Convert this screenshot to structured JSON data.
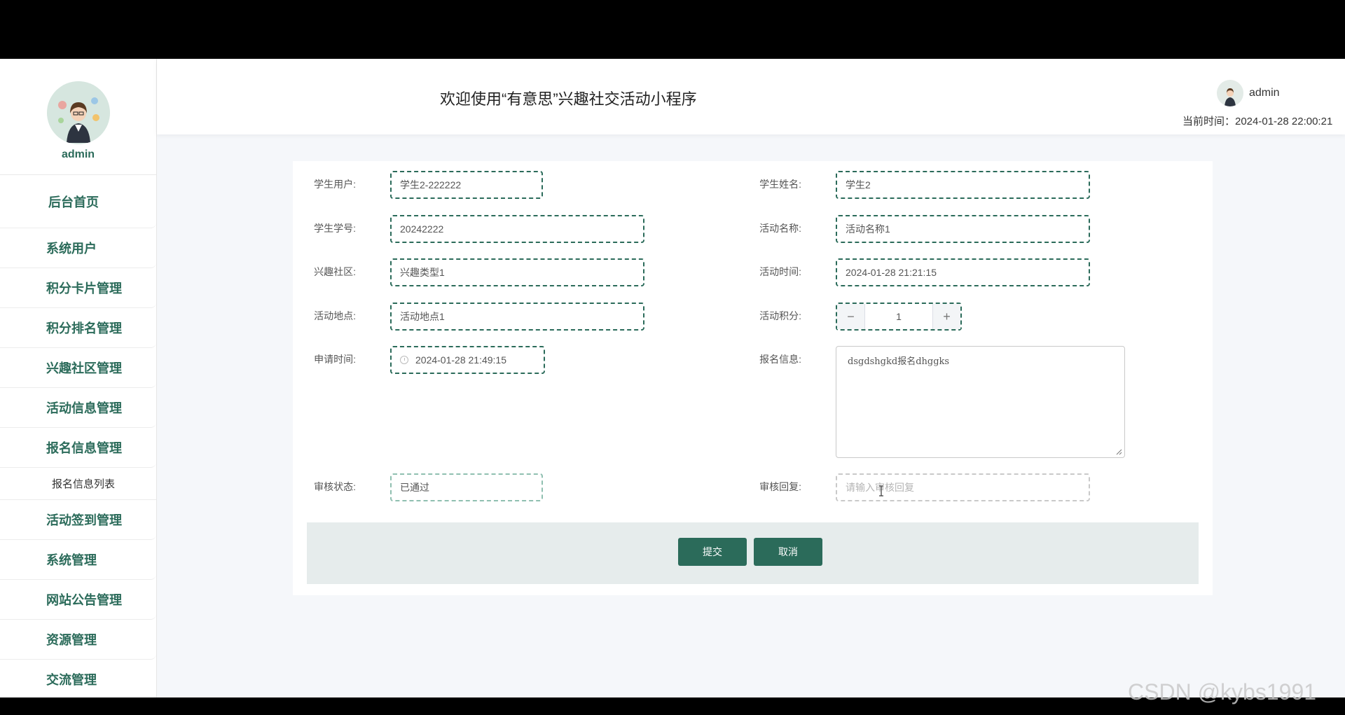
{
  "sidebar": {
    "username": "admin",
    "items": [
      {
        "label": "后台首页"
      },
      {
        "label": "系统用户"
      },
      {
        "label": "积分卡片管理"
      },
      {
        "label": "积分排名管理"
      },
      {
        "label": "兴趣社区管理"
      },
      {
        "label": "活动信息管理"
      },
      {
        "label": "报名信息管理"
      }
    ],
    "subitem": "报名信息列表",
    "items_after": [
      {
        "label": "活动签到管理"
      },
      {
        "label": "系统管理"
      },
      {
        "label": "网站公告管理"
      },
      {
        "label": "资源管理"
      },
      {
        "label": "交流管理"
      }
    ]
  },
  "header": {
    "title": "欢迎使用“有意思”兴趣社交活动小程序",
    "username": "admin",
    "time": "当前时间：2024-01-28 22:00:21"
  },
  "form": {
    "student_user": {
      "label": "学生用户:",
      "value": "学生2-222222"
    },
    "student_name": {
      "label": "学生姓名:",
      "value": "学生2"
    },
    "student_no": {
      "label": "学生学号:",
      "value": "20242222"
    },
    "activity_name": {
      "label": "活动名称:",
      "value": "活动名称1"
    },
    "community": {
      "label": "兴趣社区:",
      "value": "兴趣类型1"
    },
    "activity_time": {
      "label": "活动时间:",
      "value": "2024-01-28 21:21:15"
    },
    "location": {
      "label": "活动地点:",
      "value": "活动地点1"
    },
    "points": {
      "label": "活动积分:",
      "value": "1",
      "minus": "−",
      "plus": "+"
    },
    "apply_time": {
      "label": "申请时间:",
      "value": "2024-01-28 21:49:15"
    },
    "signup_info": {
      "label": "报名信息:",
      "value": "dsgdshgkd报名dhggks"
    },
    "review_status": {
      "label": "审核状态:",
      "value": "已通过"
    },
    "review_reply": {
      "label": "审核回复:",
      "placeholder": "请输入审核回复"
    }
  },
  "buttons": {
    "submit": "提交",
    "cancel": "取消"
  },
  "watermark": "CSDN @kybs1991"
}
